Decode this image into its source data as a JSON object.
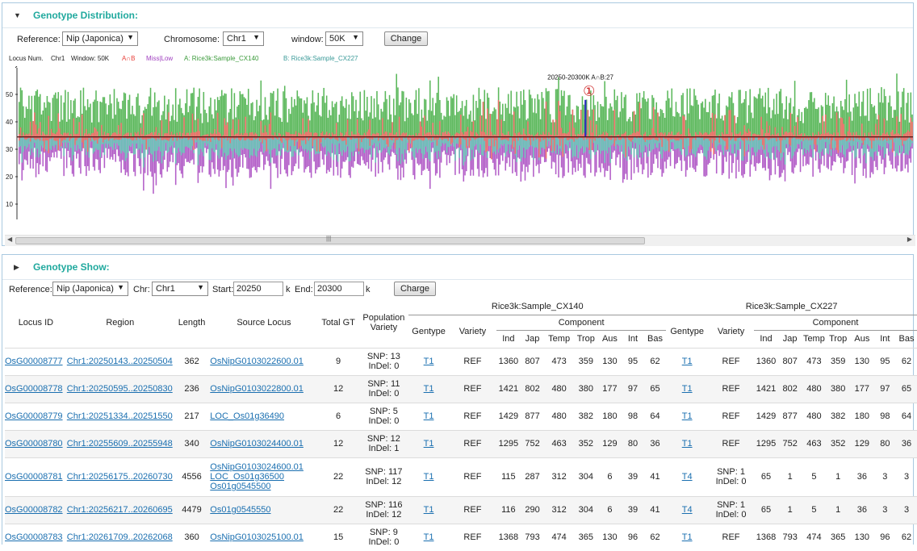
{
  "dist": {
    "title": "Genotype Distribution:",
    "reference_label": "Reference:",
    "reference_value": "Nip (Japonica)",
    "chromosome_label": "Chromosome:",
    "chromosome_value": "Chr1",
    "window_label": "window:",
    "window_value": "50K",
    "change_label": "Change"
  },
  "legend": {
    "locus_num": "Locus Num.",
    "chr": "Chr1",
    "window": "Window: 50K",
    "anb": "A∩B",
    "miss": "Miss|Low",
    "a": "A: Rice3k:Sample_CX140",
    "b": "B: Rice3k:Sample_CX227"
  },
  "chart_data": {
    "type": "bar",
    "y_ticks": [
      "50",
      "40",
      "30",
      "20",
      "10"
    ],
    "annotation": "20250-20300K A∩B:27",
    "marker": "①",
    "colors": {
      "a_green": "#5cb85c",
      "anb_red": "#f0706a",
      "miss_purple": "#b35fc8",
      "b_teal": "#6cc1b8",
      "baseline": "#5a1a1a",
      "highlight": "#2b2bbf"
    },
    "highlight_bin": 405,
    "bin_count": 640,
    "description_note": ""
  },
  "show": {
    "title": "Genotype Show:",
    "reference_label": "Reference:",
    "reference_value": "Nip (Japonica)",
    "chr_label": "Chr:",
    "chr_value": "Chr1",
    "start_label": "Start:",
    "start_value": "20250",
    "start_unit": "k",
    "end_label": "End:",
    "end_value": "20300",
    "end_unit": "k",
    "charge_label": "Charge"
  },
  "table": {
    "headers": {
      "locus_id": "Locus ID",
      "region": "Region",
      "length": "Length",
      "source_locus": "Source Locus",
      "total_gt": "Total GT",
      "population": "Population",
      "variety_l": "Variety",
      "sample_a": "Rice3k:Sample_CX140",
      "sample_b": "Rice3k:Sample_CX227",
      "gentype": "Gentype",
      "variety": "Variety",
      "component": "Component",
      "ind": "Ind",
      "jap": "Jap",
      "temp": "Temp",
      "trop": "Trop",
      "aus": "Aus",
      "int": "Int",
      "bas": "Bas"
    },
    "rows": [
      {
        "locus": "OsG00008777",
        "region": "Chr1:20250143..20250504",
        "length": "362",
        "source": [
          "OsNipG0103022600.01"
        ],
        "total": "9",
        "pop1": "SNP: 13",
        "pop2": "InDel: 0",
        "ga": "T1",
        "va": "REF",
        "ca": [
          "1360",
          "807",
          "473",
          "359",
          "130",
          "95",
          "62"
        ],
        "gb": "T1",
        "vb": "REF",
        "cb": [
          "1360",
          "807",
          "473",
          "359",
          "130",
          "95",
          "62"
        ]
      },
      {
        "locus": "OsG00008778",
        "region": "Chr1:20250595..20250830",
        "length": "236",
        "source": [
          "OsNipG0103022800.01"
        ],
        "total": "12",
        "pop1": "SNP: 11",
        "pop2": "InDel: 0",
        "ga": "T1",
        "va": "REF",
        "ca": [
          "1421",
          "802",
          "480",
          "380",
          "177",
          "97",
          "65"
        ],
        "gb": "T1",
        "vb": "REF",
        "cb": [
          "1421",
          "802",
          "480",
          "380",
          "177",
          "97",
          "65"
        ]
      },
      {
        "locus": "OsG00008779",
        "region": "Chr1:20251334..20251550",
        "length": "217",
        "source": [
          "LOC_Os01g36490"
        ],
        "total": "6",
        "pop1": "SNP: 5",
        "pop2": "InDel: 0",
        "ga": "T1",
        "va": "REF",
        "ca": [
          "1429",
          "877",
          "480",
          "382",
          "180",
          "98",
          "64"
        ],
        "gb": "T1",
        "vb": "REF",
        "cb": [
          "1429",
          "877",
          "480",
          "382",
          "180",
          "98",
          "64"
        ]
      },
      {
        "locus": "OsG00008780",
        "region": "Chr1:20255609..20255948",
        "length": "340",
        "source": [
          "OsNipG0103024400.01"
        ],
        "total": "12",
        "pop1": "SNP: 12",
        "pop2": "InDel: 1",
        "ga": "T1",
        "va": "REF",
        "ca": [
          "1295",
          "752",
          "463",
          "352",
          "129",
          "80",
          "36"
        ],
        "gb": "T1",
        "vb": "REF",
        "cb": [
          "1295",
          "752",
          "463",
          "352",
          "129",
          "80",
          "36"
        ]
      },
      {
        "locus": "OsG00008781",
        "region": "Chr1:20256175..20260730",
        "length": "4556",
        "source": [
          "OsNipG0103024600.01",
          "LOC_Os01g36500",
          "Os01g0545500"
        ],
        "total": "22",
        "pop1": "SNP: 117",
        "pop2": "InDel: 12",
        "ga": "T1",
        "va": "REF",
        "ca": [
          "115",
          "287",
          "312",
          "304",
          "6",
          "39",
          "41"
        ],
        "gb": "T4",
        "vb": "SNP: 1|InDel: 0",
        "cb": [
          "65",
          "1",
          "5",
          "1",
          "36",
          "3",
          "3"
        ]
      },
      {
        "locus": "OsG00008782",
        "region": "Chr1:20256217..20260695",
        "length": "4479",
        "source": [
          "Os01g0545550"
        ],
        "total": "22",
        "pop1": "SNP: 116",
        "pop2": "InDel: 12",
        "ga": "T1",
        "va": "REF",
        "ca": [
          "116",
          "290",
          "312",
          "304",
          "6",
          "39",
          "41"
        ],
        "gb": "T4",
        "vb": "SNP: 1|InDel: 0",
        "cb": [
          "65",
          "1",
          "5",
          "1",
          "36",
          "3",
          "3"
        ]
      },
      {
        "locus": "OsG00008783",
        "region": "Chr1:20261709..20262068",
        "length": "360",
        "source": [
          "OsNipG0103025100.01"
        ],
        "total": "15",
        "pop1": "SNP: 9",
        "pop2": "InDel: 0",
        "ga": "T1",
        "va": "REF",
        "ca": [
          "1368",
          "793",
          "474",
          "365",
          "130",
          "96",
          "62"
        ],
        "gb": "T1",
        "vb": "REF",
        "cb": [
          "1368",
          "793",
          "474",
          "365",
          "130",
          "96",
          "62"
        ]
      }
    ]
  }
}
